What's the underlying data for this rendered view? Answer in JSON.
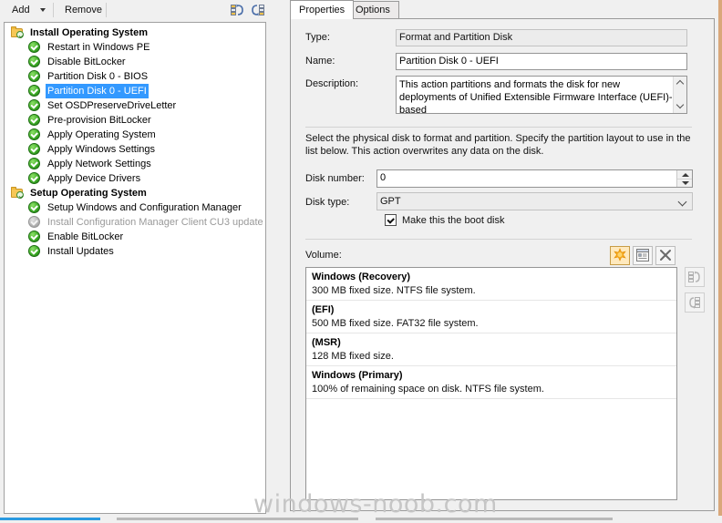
{
  "toolbar": {
    "add_label": "Add",
    "remove_label": "Remove",
    "collapse_icon": "collapse-tree-icon",
    "expand_icon": "expand-tree-icon"
  },
  "tree": {
    "groups": [
      {
        "label": "Install Operating System",
        "icon": "folder-check-icon",
        "items": [
          {
            "label": "Restart in Windows PE",
            "enabled": true,
            "selected": false
          },
          {
            "label": "Disable BitLocker",
            "enabled": true,
            "selected": false
          },
          {
            "label": "Partition Disk 0 - BIOS",
            "enabled": true,
            "selected": false
          },
          {
            "label": "Partition Disk 0 - UEFI",
            "enabled": true,
            "selected": true
          },
          {
            "label": "Set OSDPreserveDriveLetter",
            "enabled": true,
            "selected": false
          },
          {
            "label": "Pre-provision BitLocker",
            "enabled": true,
            "selected": false
          },
          {
            "label": "Apply Operating System",
            "enabled": true,
            "selected": false
          },
          {
            "label": "Apply Windows Settings",
            "enabled": true,
            "selected": false
          },
          {
            "label": "Apply Network Settings",
            "enabled": true,
            "selected": false
          },
          {
            "label": "Apply Device Drivers",
            "enabled": true,
            "selected": false
          }
        ]
      },
      {
        "label": "Setup Operating System",
        "icon": "folder-check-icon",
        "items": [
          {
            "label": "Setup Windows and Configuration Manager",
            "enabled": true,
            "selected": false
          },
          {
            "label": "Install Configuration Manager Client CU3 update",
            "enabled": false,
            "selected": false
          },
          {
            "label": "Enable BitLocker",
            "enabled": true,
            "selected": false
          },
          {
            "label": "Install Updates",
            "enabled": true,
            "selected": false
          }
        ]
      }
    ]
  },
  "tabs": [
    {
      "label": "Properties",
      "active": true
    },
    {
      "label": "Options",
      "active": false
    }
  ],
  "properties": {
    "type_label": "Type:",
    "type_value": "Format and Partition Disk",
    "name_label": "Name:",
    "name_value": "Partition Disk 0 - UEFI",
    "description_label": "Description:",
    "description_value": "This action partitions and formats the disk for new deployments of Unified Extensible Firmware Interface (UEFI)-based",
    "help_text": "Select the physical disk to format and partition. Specify the partition layout to use in the list below. This action overwrites any data on the disk.",
    "disk_number_label": "Disk number:",
    "disk_number_value": "0",
    "disk_type_label": "Disk type:",
    "disk_type_value": "GPT",
    "boot_disk_label": "Make this the boot disk",
    "boot_disk_checked": true
  },
  "volume": {
    "label": "Volume:",
    "actions": [
      {
        "name": "new-volume-icon",
        "state": "enabled"
      },
      {
        "name": "volume-properties-icon",
        "state": "enabled"
      },
      {
        "name": "delete-volume-icon",
        "state": "enabled"
      }
    ],
    "side_actions": [
      {
        "name": "move-up-icon",
        "state": "disabled"
      },
      {
        "name": "move-down-icon",
        "state": "disabled"
      }
    ],
    "rows": [
      {
        "title": "Windows (Recovery)",
        "subtitle": "300 MB fixed size. NTFS file system."
      },
      {
        "title": " (EFI)",
        "subtitle": "500 MB fixed size. FAT32 file system."
      },
      {
        "title": " (MSR)",
        "subtitle": "128 MB fixed size."
      },
      {
        "title": "Windows (Primary)",
        "subtitle": "100% of remaining space on disk. NTFS file system."
      }
    ]
  },
  "watermark": "windows-noob.com",
  "colors": {
    "selection": "#3399ff",
    "check_green": "#3fae27",
    "folder_yellow": "#f6c756",
    "highlight_orange": "#ffe9bd",
    "accent_blue": "#2b9ae0",
    "window_bg": "#f0f0f0"
  }
}
